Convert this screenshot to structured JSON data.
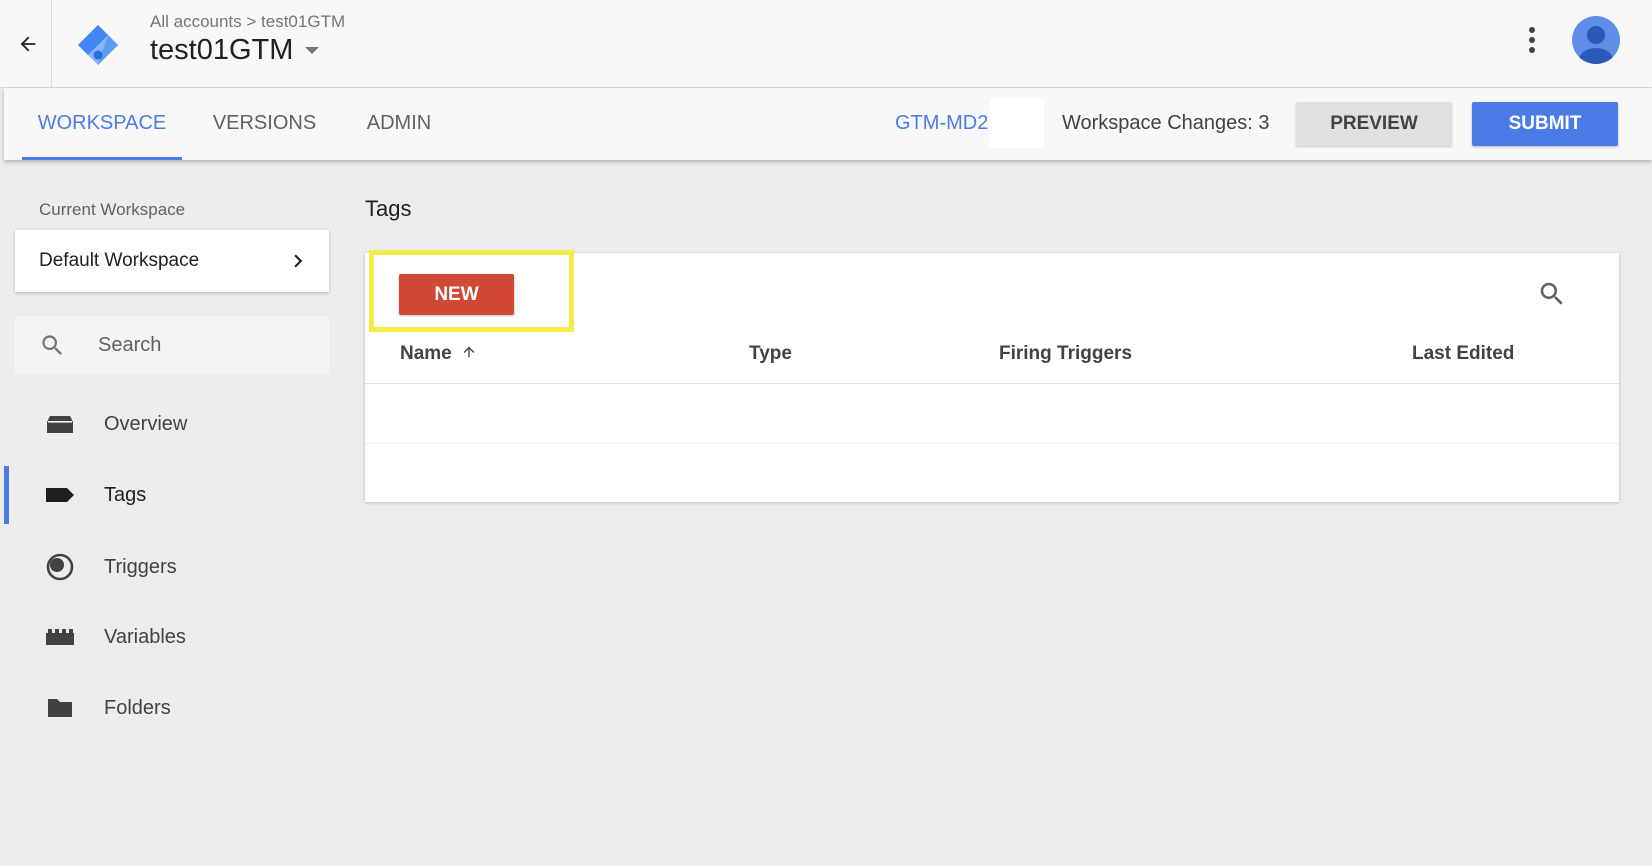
{
  "header": {
    "breadcrumb": "All accounts > test01GTM",
    "container_name": "test01GTM"
  },
  "nav": {
    "tabs": [
      {
        "label": "WORKSPACE",
        "active": true
      },
      {
        "label": "VERSIONS",
        "active": false
      },
      {
        "label": "ADMIN",
        "active": false
      }
    ],
    "container_id": "GTM-MD2",
    "workspace_changes": "Workspace Changes: 3",
    "preview_label": "PREVIEW",
    "submit_label": "SUBMIT"
  },
  "sidebar": {
    "current_workspace_label": "Current Workspace",
    "workspace_name": "Default Workspace",
    "search_placeholder": "Search",
    "items": [
      {
        "label": "Overview",
        "icon": "overview-icon",
        "active": false
      },
      {
        "label": "Tags",
        "icon": "tag-icon",
        "active": true
      },
      {
        "label": "Triggers",
        "icon": "trigger-icon",
        "active": false
      },
      {
        "label": "Variables",
        "icon": "variables-icon",
        "active": false
      },
      {
        "label": "Folders",
        "icon": "folder-icon",
        "active": false
      }
    ]
  },
  "main": {
    "title": "Tags",
    "new_button_label": "NEW",
    "columns": [
      "Name",
      "Type",
      "Firing Triggers",
      "Last Edited"
    ],
    "sort_column": "Name",
    "sort_direction": "ascending",
    "rows": []
  },
  "colors": {
    "accent": "#4a7ce8",
    "new_button": "#d14836",
    "highlight": "#f7ea46",
    "background": "#ececec"
  }
}
